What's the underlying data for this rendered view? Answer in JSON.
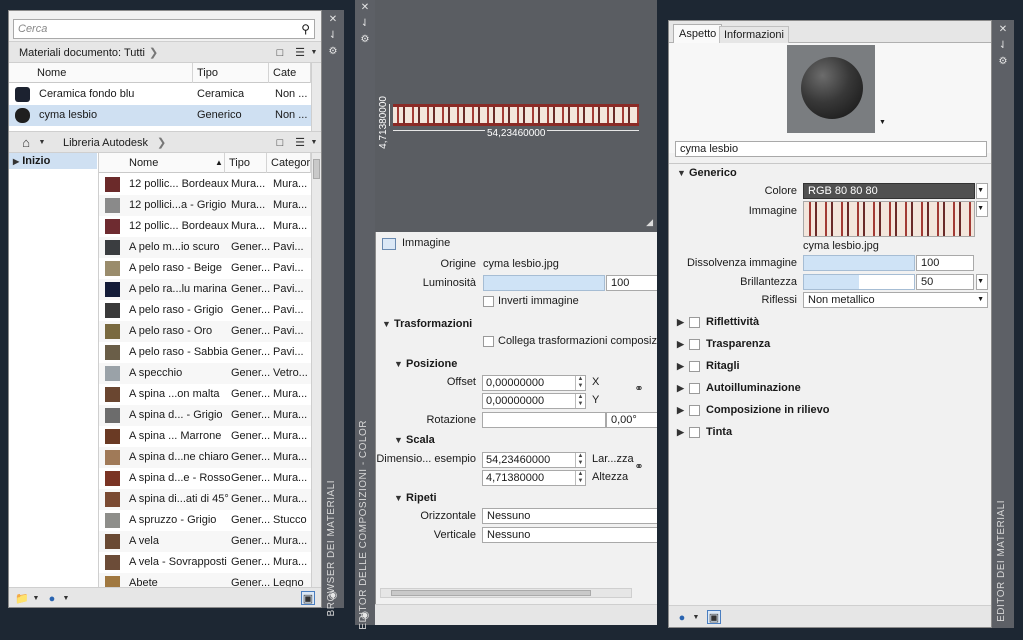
{
  "browser": {
    "search_placeholder": "Cerca",
    "doc_filter": "Materiali documento: Tutti",
    "doc_columns": [
      "Nome",
      "Tipo",
      "Cate"
    ],
    "doc_rows": [
      {
        "name": "Ceramica fondo blu",
        "type": "Ceramica",
        "cat": "Non ...",
        "color": "#1c2230"
      },
      {
        "name": "cyma lesbio",
        "type": "Generico",
        "cat": "Non ...",
        "color": "#1f1f1f"
      }
    ],
    "library_label": "Libreria Autodesk",
    "tree_item": "Inizio",
    "lib_columns": [
      "Nome",
      "Tipo",
      "Categor"
    ],
    "lib_rows": [
      {
        "name": "12 pollic... Bordeaux",
        "type": "Mura...",
        "cat": "Mura...",
        "color": "#6b2a2a"
      },
      {
        "name": "12 pollici...a - Grigio",
        "type": "Mura...",
        "cat": "Mura...",
        "color": "#8a8a8a"
      },
      {
        "name": "12 pollic... Bordeaux",
        "type": "Mura...",
        "cat": "Mura...",
        "color": "#6e2b30"
      },
      {
        "name": "A pelo m...io scuro",
        "type": "Gener...",
        "cat": "Pavi...",
        "color": "#3a3d40"
      },
      {
        "name": "A pelo raso - Beige",
        "type": "Gener...",
        "cat": "Pavi...",
        "color": "#9a8c6c"
      },
      {
        "name": "A pelo ra...lu marina",
        "type": "Gener...",
        "cat": "Pavi...",
        "color": "#141c38"
      },
      {
        "name": "A pelo raso - Grigio",
        "type": "Gener...",
        "cat": "Pavi...",
        "color": "#3a3a3a"
      },
      {
        "name": "A pelo raso - Oro",
        "type": "Gener...",
        "cat": "Pavi...",
        "color": "#7a6a40"
      },
      {
        "name": "A pelo raso - Sabbia",
        "type": "Gener...",
        "cat": "Pavi...",
        "color": "#6a5e48"
      },
      {
        "name": "A specchio",
        "type": "Gener...",
        "cat": "Vetro...",
        "color": "#9aa2a8"
      },
      {
        "name": "A spina ...on malta",
        "type": "Gener...",
        "cat": "Mura...",
        "color": "#6a4630"
      },
      {
        "name": "A spina d... - Grigio",
        "type": "Gener...",
        "cat": "Mura...",
        "color": "#6c6c6c"
      },
      {
        "name": "A spina ... Marrone",
        "type": "Gener...",
        "cat": "Mura...",
        "color": "#6a3a24"
      },
      {
        "name": "A spina d...ne chiaro",
        "type": "Gener...",
        "cat": "Mura...",
        "color": "#a07a58"
      },
      {
        "name": "A spina d...e - Rosso",
        "type": "Gener...",
        "cat": "Mura...",
        "color": "#7a3424"
      },
      {
        "name": "A spina di...ati di 45°",
        "type": "Gener...",
        "cat": "Mura...",
        "color": "#7a4a32"
      },
      {
        "name": "A spruzzo - Grigio",
        "type": "Gener...",
        "cat": "Stucco",
        "color": "#8e8e8a"
      },
      {
        "name": "A vela",
        "type": "Gener...",
        "cat": "Mura...",
        "color": "#6a4a34"
      },
      {
        "name": "A vela - Sovrapposti",
        "type": "Gener...",
        "cat": "Mura...",
        "color": "#6c4c38"
      },
      {
        "name": "Abete",
        "type": "Gener...",
        "cat": "Legno",
        "color": "#a07840"
      }
    ],
    "side_title": "BROWSER DEI MATERIALI"
  },
  "composition": {
    "dim_width": "54,23460000",
    "dim_height": "4,71380000",
    "side_title": "EDITOR DELLE COMPOSIZIONI - COLOR",
    "image_header": "Immagine",
    "origin_label": "Origine",
    "origin_value": "cyma lesbio.jpg",
    "luminosity_label": "Luminosità",
    "luminosity_value": "100",
    "luminosity_level": 1.0,
    "invert_label": "Inverti immagine",
    "transform_header": "Trasformazioni",
    "link_label": "Collega trasformazioni composizione",
    "position_header": "Posizione",
    "offset_label": "Offset",
    "offset_x": "0,00000000",
    "offset_y": "0,00000000",
    "x_label": "X",
    "y_label": "Y",
    "rotation_label": "Rotazione",
    "rotation_value": "0,00°",
    "scale_header": "Scala",
    "dim_label": "Dimensio... esempio",
    "scale_w": "54,23460000",
    "scale_h": "4,71380000",
    "width_label": "Lar...zza",
    "height_label": "Altezza",
    "repeat_header": "Ripeti",
    "horizontal_label": "Orizzontale",
    "horizontal_value": "Nessuno",
    "vertical_label": "Verticale",
    "vertical_value": "Nessuno"
  },
  "editor": {
    "tabs": [
      "Aspetto",
      "Informazioni"
    ],
    "material_name": "cyma lesbio",
    "generic_header": "Generico",
    "color_label": "Colore",
    "color_value": "RGB 80 80 80",
    "image_label": "Immagine",
    "image_file": "cyma lesbio.jpg",
    "fade_label": "Dissolvenza immagine",
    "fade_value": "100",
    "fade_level": 1.0,
    "gloss_label": "Brillantezza",
    "gloss_value": "50",
    "gloss_level": 0.5,
    "reflections_label": "Riflessi",
    "reflections_value": "Non metallico",
    "sections": [
      "Riflettività",
      "Trasparenza",
      "Ritagli",
      "Autoilluminazione",
      "Composizione in rilievo",
      "Tinta"
    ],
    "side_title": "EDITOR DEI MATERIALI"
  }
}
